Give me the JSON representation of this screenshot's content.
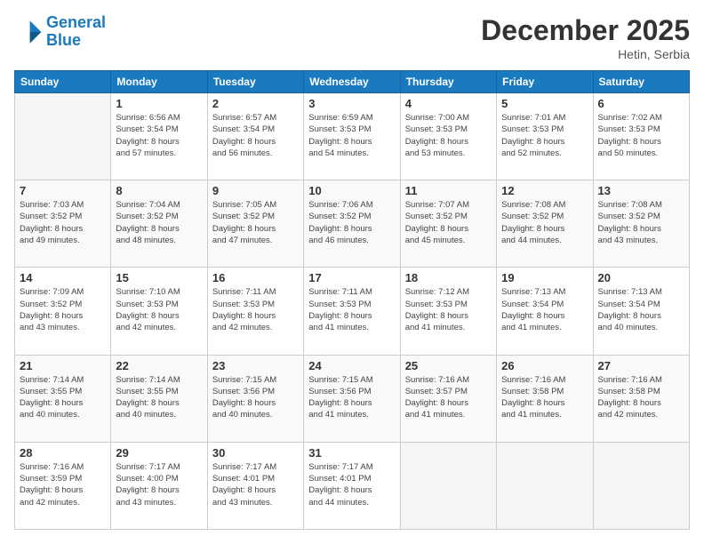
{
  "header": {
    "logo_line1": "General",
    "logo_line2": "Blue",
    "month_year": "December 2025",
    "location": "Hetin, Serbia"
  },
  "days_of_week": [
    "Sunday",
    "Monday",
    "Tuesday",
    "Wednesday",
    "Thursday",
    "Friday",
    "Saturday"
  ],
  "weeks": [
    [
      {
        "day": "",
        "info": ""
      },
      {
        "day": "1",
        "info": "Sunrise: 6:56 AM\nSunset: 3:54 PM\nDaylight: 8 hours\nand 57 minutes."
      },
      {
        "day": "2",
        "info": "Sunrise: 6:57 AM\nSunset: 3:54 PM\nDaylight: 8 hours\nand 56 minutes."
      },
      {
        "day": "3",
        "info": "Sunrise: 6:59 AM\nSunset: 3:53 PM\nDaylight: 8 hours\nand 54 minutes."
      },
      {
        "day": "4",
        "info": "Sunrise: 7:00 AM\nSunset: 3:53 PM\nDaylight: 8 hours\nand 53 minutes."
      },
      {
        "day": "5",
        "info": "Sunrise: 7:01 AM\nSunset: 3:53 PM\nDaylight: 8 hours\nand 52 minutes."
      },
      {
        "day": "6",
        "info": "Sunrise: 7:02 AM\nSunset: 3:53 PM\nDaylight: 8 hours\nand 50 minutes."
      }
    ],
    [
      {
        "day": "7",
        "info": "Sunrise: 7:03 AM\nSunset: 3:52 PM\nDaylight: 8 hours\nand 49 minutes."
      },
      {
        "day": "8",
        "info": "Sunrise: 7:04 AM\nSunset: 3:52 PM\nDaylight: 8 hours\nand 48 minutes."
      },
      {
        "day": "9",
        "info": "Sunrise: 7:05 AM\nSunset: 3:52 PM\nDaylight: 8 hours\nand 47 minutes."
      },
      {
        "day": "10",
        "info": "Sunrise: 7:06 AM\nSunset: 3:52 PM\nDaylight: 8 hours\nand 46 minutes."
      },
      {
        "day": "11",
        "info": "Sunrise: 7:07 AM\nSunset: 3:52 PM\nDaylight: 8 hours\nand 45 minutes."
      },
      {
        "day": "12",
        "info": "Sunrise: 7:08 AM\nSunset: 3:52 PM\nDaylight: 8 hours\nand 44 minutes."
      },
      {
        "day": "13",
        "info": "Sunrise: 7:08 AM\nSunset: 3:52 PM\nDaylight: 8 hours\nand 43 minutes."
      }
    ],
    [
      {
        "day": "14",
        "info": "Sunrise: 7:09 AM\nSunset: 3:52 PM\nDaylight: 8 hours\nand 43 minutes."
      },
      {
        "day": "15",
        "info": "Sunrise: 7:10 AM\nSunset: 3:53 PM\nDaylight: 8 hours\nand 42 minutes."
      },
      {
        "day": "16",
        "info": "Sunrise: 7:11 AM\nSunset: 3:53 PM\nDaylight: 8 hours\nand 42 minutes."
      },
      {
        "day": "17",
        "info": "Sunrise: 7:11 AM\nSunset: 3:53 PM\nDaylight: 8 hours\nand 41 minutes."
      },
      {
        "day": "18",
        "info": "Sunrise: 7:12 AM\nSunset: 3:53 PM\nDaylight: 8 hours\nand 41 minutes."
      },
      {
        "day": "19",
        "info": "Sunrise: 7:13 AM\nSunset: 3:54 PM\nDaylight: 8 hours\nand 41 minutes."
      },
      {
        "day": "20",
        "info": "Sunrise: 7:13 AM\nSunset: 3:54 PM\nDaylight: 8 hours\nand 40 minutes."
      }
    ],
    [
      {
        "day": "21",
        "info": "Sunrise: 7:14 AM\nSunset: 3:55 PM\nDaylight: 8 hours\nand 40 minutes."
      },
      {
        "day": "22",
        "info": "Sunrise: 7:14 AM\nSunset: 3:55 PM\nDaylight: 8 hours\nand 40 minutes."
      },
      {
        "day": "23",
        "info": "Sunrise: 7:15 AM\nSunset: 3:56 PM\nDaylight: 8 hours\nand 40 minutes."
      },
      {
        "day": "24",
        "info": "Sunrise: 7:15 AM\nSunset: 3:56 PM\nDaylight: 8 hours\nand 41 minutes."
      },
      {
        "day": "25",
        "info": "Sunrise: 7:16 AM\nSunset: 3:57 PM\nDaylight: 8 hours\nand 41 minutes."
      },
      {
        "day": "26",
        "info": "Sunrise: 7:16 AM\nSunset: 3:58 PM\nDaylight: 8 hours\nand 41 minutes."
      },
      {
        "day": "27",
        "info": "Sunrise: 7:16 AM\nSunset: 3:58 PM\nDaylight: 8 hours\nand 42 minutes."
      }
    ],
    [
      {
        "day": "28",
        "info": "Sunrise: 7:16 AM\nSunset: 3:59 PM\nDaylight: 8 hours\nand 42 minutes."
      },
      {
        "day": "29",
        "info": "Sunrise: 7:17 AM\nSunset: 4:00 PM\nDaylight: 8 hours\nand 43 minutes."
      },
      {
        "day": "30",
        "info": "Sunrise: 7:17 AM\nSunset: 4:01 PM\nDaylight: 8 hours\nand 43 minutes."
      },
      {
        "day": "31",
        "info": "Sunrise: 7:17 AM\nSunset: 4:01 PM\nDaylight: 8 hours\nand 44 minutes."
      },
      {
        "day": "",
        "info": ""
      },
      {
        "day": "",
        "info": ""
      },
      {
        "day": "",
        "info": ""
      }
    ]
  ]
}
